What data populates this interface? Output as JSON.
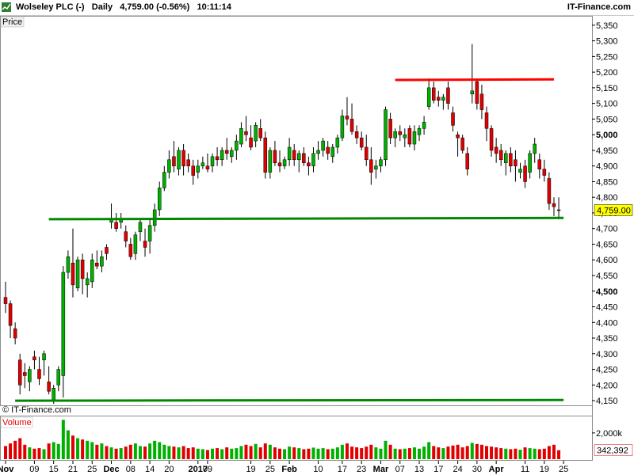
{
  "header": {
    "instrument": "Wolseley PLC (-)",
    "period": "Daily",
    "price": "4,759.00 (-0.56%)",
    "time": "10:11:14",
    "brand": "IT-Finance.com"
  },
  "price_panel": {
    "label": "Price",
    "watermark": "© IT-Finance.com",
    "last_price_label": "4,759.00"
  },
  "volume_panel": {
    "label": "Volume",
    "tick_label": "2,000k",
    "last_volume_label": "342,392"
  },
  "colors": {
    "up": "#00b000",
    "down": "#e00000",
    "support": "#008800",
    "resistance": "#ff0000",
    "last_tag": "#ffff00"
  },
  "chart_data": {
    "type": "candlestick",
    "price_axis": {
      "range": [
        4135,
        5380
      ],
      "ticks": [
        "4,150",
        "4,200",
        "4,250",
        "4,300",
        "4,350",
        "4,400",
        "4,450",
        "4,500",
        "4,550",
        "4,600",
        "4,650",
        "4,700",
        "4,750",
        "4,800",
        "4,850",
        "4,900",
        "4,950",
        "5,000",
        "5,050",
        "5,100",
        "5,150",
        "5,200",
        "5,250",
        "5,300",
        "5,350"
      ],
      "bold_ticks": [
        "4,500",
        "5,000"
      ]
    },
    "x_axis": {
      "labels": [
        {
          "i": 0,
          "t": "Nov",
          "bold": true
        },
        {
          "i": 6,
          "t": "09",
          "bold": false
        },
        {
          "i": 10,
          "t": "15",
          "bold": false
        },
        {
          "i": 14,
          "t": "21",
          "bold": false
        },
        {
          "i": 18,
          "t": "25",
          "bold": false
        },
        {
          "i": 22,
          "t": "Dec",
          "bold": true
        },
        {
          "i": 26,
          "t": "08",
          "bold": false
        },
        {
          "i": 30,
          "t": "14",
          "bold": false
        },
        {
          "i": 34,
          "t": "20",
          "bold": false
        },
        {
          "i": 40,
          "t": "2017",
          "bold": true
        },
        {
          "i": 42,
          "t": "09",
          "bold": false
        },
        {
          "i": 51,
          "t": "19",
          "bold": false
        },
        {
          "i": 55,
          "t": "25",
          "bold": false
        },
        {
          "i": 59,
          "t": "Feb",
          "bold": true
        },
        {
          "i": 65,
          "t": "10",
          "bold": false
        },
        {
          "i": 70,
          "t": "17",
          "bold": false
        },
        {
          "i": 74,
          "t": "23",
          "bold": false
        },
        {
          "i": 78,
          "t": "Mar",
          "bold": true
        },
        {
          "i": 82,
          "t": "07",
          "bold": false
        },
        {
          "i": 86,
          "t": "13",
          "bold": false
        },
        {
          "i": 90,
          "t": "17",
          "bold": false
        },
        {
          "i": 94,
          "t": "24",
          "bold": false
        },
        {
          "i": 98,
          "t": "30",
          "bold": false
        },
        {
          "i": 102,
          "t": "Apr",
          "bold": true
        },
        {
          "i": 108,
          "t": "11",
          "bold": false
        },
        {
          "i": 112,
          "t": "19",
          "bold": false
        },
        {
          "i": 116,
          "t": "25",
          "bold": false
        }
      ]
    },
    "candles": [
      [
        4480,
        4530,
        4430,
        4460,
        50
      ],
      [
        4460,
        4470,
        4350,
        4390,
        60
      ],
      [
        4380,
        4400,
        4330,
        4350,
        70
      ],
      [
        4280,
        4300,
        4170,
        4200,
        80
      ],
      [
        4240,
        4270,
        4190,
        4230,
        55
      ],
      [
        4210,
        4260,
        4180,
        4250,
        45
      ],
      [
        4290,
        4310,
        4250,
        4280,
        40
      ],
      [
        4250,
        4290,
        4200,
        4220,
        42
      ],
      [
        4280,
        4310,
        4230,
        4300,
        38
      ],
      [
        4210,
        4260,
        4170,
        4180,
        60
      ],
      [
        4150,
        4200,
        4140,
        4190,
        65
      ],
      [
        4200,
        4260,
        4180,
        4250,
        58
      ],
      [
        4230,
        4580,
        4160,
        4560,
        150
      ],
      [
        4560,
        4630,
        4540,
        4610,
        110
      ],
      [
        4590,
        4700,
        4480,
        4520,
        90
      ],
      [
        4510,
        4610,
        4500,
        4600,
        80
      ],
      [
        4600,
        4620,
        4490,
        4540,
        75
      ],
      [
        4520,
        4560,
        4480,
        4540,
        70
      ],
      [
        4530,
        4620,
        4510,
        4600,
        65
      ],
      [
        4590,
        4630,
        4570,
        4580,
        55
      ],
      [
        4580,
        4630,
        4560,
        4610,
        60
      ],
      [
        4640,
        4650,
        4600,
        4620,
        50
      ],
      [
        4720,
        4780,
        4700,
        4730,
        45
      ],
      [
        4720,
        4750,
        4690,
        4700,
        40
      ],
      [
        4720,
        4750,
        4700,
        4730,
        42
      ],
      [
        4690,
        4710,
        4640,
        4660,
        48
      ],
      [
        4650,
        4670,
        4600,
        4610,
        55
      ],
      [
        4620,
        4690,
        4600,
        4680,
        60
      ],
      [
        4690,
        4730,
        4660,
        4720,
        50
      ],
      [
        4660,
        4700,
        4610,
        4640,
        48
      ],
      [
        4660,
        4730,
        4620,
        4710,
        60
      ],
      [
        4710,
        4780,
        4690,
        4760,
        70
      ],
      [
        4760,
        4850,
        4740,
        4830,
        65
      ],
      [
        4830,
        4900,
        4820,
        4880,
        55
      ],
      [
        4880,
        4950,
        4860,
        4920,
        50
      ],
      [
        4930,
        4980,
        4880,
        4900,
        48
      ],
      [
        4890,
        4960,
        4870,
        4950,
        45
      ],
      [
        4950,
        4970,
        4870,
        4900,
        50
      ],
      [
        4920,
        4940,
        4880,
        4900,
        42
      ],
      [
        4900,
        4920,
        4840,
        4870,
        45
      ],
      [
        4880,
        4920,
        4860,
        4900,
        40
      ],
      [
        4900,
        4930,
        4890,
        4910,
        38
      ],
      [
        4900,
        4940,
        4880,
        4890,
        35
      ],
      [
        4900,
        4940,
        4880,
        4930,
        40
      ],
      [
        4930,
        4960,
        4900,
        4920,
        42
      ],
      [
        4920,
        4960,
        4900,
        4950,
        38
      ],
      [
        4950,
        4990,
        4920,
        4940,
        45
      ],
      [
        4930,
        4960,
        4910,
        4950,
        40
      ],
      [
        4950,
        5000,
        4920,
        4980,
        42
      ],
      [
        4970,
        5040,
        4960,
        5020,
        50
      ],
      [
        5010,
        5060,
        4980,
        5000,
        55
      ],
      [
        4990,
        5030,
        4950,
        4960,
        50
      ],
      [
        4980,
        5040,
        4960,
        5030,
        58
      ],
      [
        5020,
        5050,
        4980,
        4990,
        45
      ],
      [
        4990,
        5010,
        4860,
        4880,
        60
      ],
      [
        4880,
        4960,
        4860,
        4950,
        55
      ],
      [
        4950,
        4980,
        4900,
        4910,
        45
      ],
      [
        4910,
        4950,
        4880,
        4900,
        40
      ],
      [
        4900,
        4930,
        4890,
        4920,
        38
      ],
      [
        4920,
        4990,
        4900,
        4960,
        48
      ],
      [
        4950,
        4970,
        4900,
        4920,
        45
      ],
      [
        4920,
        4950,
        4880,
        4940,
        42
      ],
      [
        4940,
        4960,
        4900,
        4910,
        38
      ],
      [
        4910,
        4930,
        4870,
        4900,
        40
      ],
      [
        4900,
        4960,
        4880,
        4940,
        44
      ],
      [
        4940,
        4980,
        4920,
        4950,
        40
      ],
      [
        4950,
        4990,
        4930,
        4980,
        42
      ],
      [
        4960,
        4980,
        4920,
        4940,
        38
      ],
      [
        4930,
        4970,
        4910,
        4960,
        40
      ],
      [
        4960,
        5000,
        4940,
        4990,
        45
      ],
      [
        4990,
        5080,
        4980,
        5060,
        55
      ],
      [
        5060,
        5120,
        5030,
        5050,
        60
      ],
      [
        5050,
        5100,
        5000,
        5010,
        48
      ],
      [
        5010,
        5030,
        4970,
        4990,
        45
      ],
      [
        4990,
        5010,
        4950,
        4960,
        42
      ],
      [
        4960,
        5000,
        4900,
        4920,
        48
      ],
      [
        4920,
        4960,
        4840,
        4880,
        55
      ],
      [
        4890,
        4920,
        4860,
        4900,
        45
      ],
      [
        4900,
        4930,
        4880,
        4920,
        40
      ],
      [
        4920,
        5090,
        4900,
        5080,
        70
      ],
      [
        5050,
        5070,
        4970,
        4990,
        55
      ],
      [
        4990,
        5020,
        4960,
        5010,
        40
      ],
      [
        5010,
        5030,
        4980,
        5000,
        38
      ],
      [
        4990,
        5020,
        4960,
        5000,
        40
      ],
      [
        5020,
        5030,
        4960,
        4970,
        42
      ],
      [
        4970,
        5030,
        4950,
        5010,
        45
      ],
      [
        5000,
        5030,
        4980,
        5020,
        40
      ],
      [
        5020,
        5060,
        5000,
        5040,
        48
      ],
      [
        5090,
        5180,
        5080,
        5150,
        65
      ],
      [
        5150,
        5170,
        5100,
        5110,
        50
      ],
      [
        5120,
        5140,
        5090,
        5110,
        45
      ],
      [
        5110,
        5130,
        5080,
        5120,
        42
      ],
      [
        5150,
        5170,
        5080,
        5100,
        48
      ],
      [
        5070,
        5090,
        5010,
        5030,
        52
      ],
      [
        5000,
        5010,
        4930,
        4990,
        55
      ],
      [
        4990,
        5000,
        4940,
        4950,
        45
      ],
      [
        4940,
        4960,
        4870,
        4890,
        50
      ],
      [
        5130,
        5290,
        5100,
        5140,
        62
      ],
      [
        5170,
        5180,
        5080,
        5100,
        58
      ],
      [
        5130,
        5160,
        5050,
        5080,
        55
      ],
      [
        5070,
        5090,
        4980,
        5020,
        50
      ],
      [
        5020,
        5030,
        4930,
        4950,
        48
      ],
      [
        4960,
        4990,
        4910,
        4940,
        45
      ],
      [
        4950,
        4970,
        4900,
        4920,
        42
      ],
      [
        4910,
        4950,
        4870,
        4940,
        40
      ],
      [
        4940,
        4960,
        4880,
        4900,
        38
      ],
      [
        4920,
        4950,
        4850,
        4900,
        40
      ],
      [
        4880,
        4910,
        4860,
        4890,
        36
      ],
      [
        4900,
        4920,
        4830,
        4850,
        45
      ],
      [
        4880,
        4950,
        4860,
        4940,
        42
      ],
      [
        4940,
        4990,
        4910,
        4970,
        40
      ],
      [
        4920,
        4940,
        4860,
        4890,
        38
      ],
      [
        4890,
        4920,
        4850,
        4870,
        40
      ],
      [
        4860,
        4880,
        4760,
        4780,
        50
      ],
      [
        4780,
        4800,
        4740,
        4770,
        55
      ],
      [
        4760,
        4800,
        4730,
        4759,
        34.2392
      ]
    ],
    "trendlines": [
      {
        "name": "support-upper",
        "from": [
          9,
          4730
        ],
        "to": [
          116,
          4734
        ],
        "color": "#008800"
      },
      {
        "name": "support-lower",
        "from": [
          2,
          4150
        ],
        "to": [
          116,
          4152
        ],
        "color": "#008800"
      },
      {
        "name": "resistance",
        "from": [
          81,
          5175
        ],
        "to": [
          114,
          5177
        ],
        "color": "#ff0000"
      }
    ],
    "volume_axis": {
      "range": [
        0,
        160
      ],
      "ticks": [
        {
          "v": 100,
          "t": "2,000k"
        }
      ]
    }
  }
}
